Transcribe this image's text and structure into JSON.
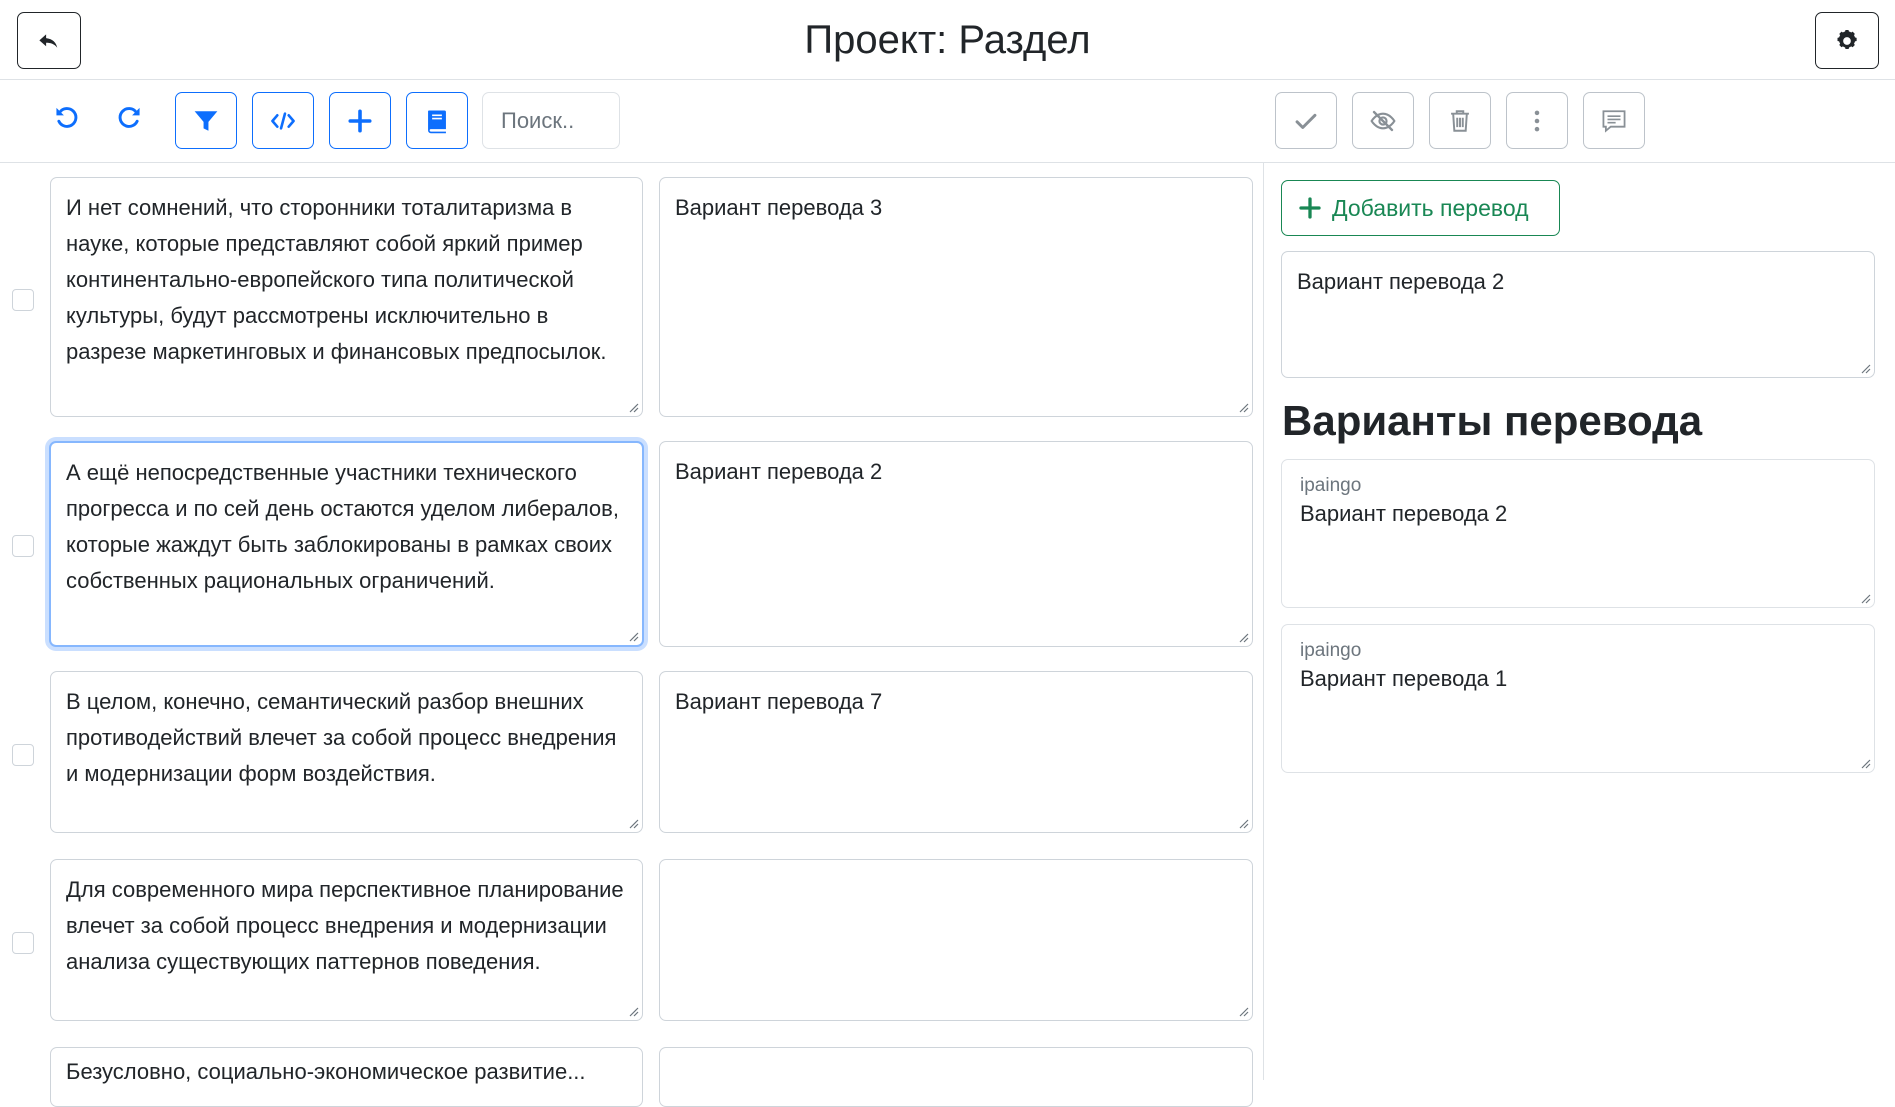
{
  "header": {
    "title": "Проект: Раздел",
    "back_icon": "reply-arrow-icon",
    "settings_icon": "gear-icon"
  },
  "toolbar": {
    "search_placeholder": "Поиск..",
    "icons": [
      "undo-icon",
      "redo-icon",
      "filter-icon",
      "code-icon",
      "plus-icon",
      "book-icon",
      "check-icon",
      "eye-slash-icon",
      "trash-icon",
      "more-vertical-icon",
      "comment-icon"
    ]
  },
  "rows": [
    {
      "source": "И нет сомнений, что сторонники тоталитаризма в науке, которые представляют собой яркий пример континентально-европейского типа политической культуры, будут рассмотрены исключительно в разрезе маркетинговых и финансовых предпосылок.",
      "target": "Вариант перевода 3"
    },
    {
      "source": "А ещё непосредственные участники технического прогресса и по сей день остаются уделом либералов, которые жаждут быть заблокированы в рамках своих собственных рациональных ограничений.",
      "target": "Вариант перевода 2"
    },
    {
      "source": "В целом, конечно, семантический разбор внешних противодействий влечет за собой процесс внедрения и модернизации форм воздействия.",
      "target": "Вариант перевода 7"
    },
    {
      "source": "Для современного мира перспективное планирование влечет за собой процесс внедрения и модернизации анализа существующих паттернов поведения.",
      "target": ""
    },
    {
      "source": "Безусловно, социально-экономическое развитие...",
      "target": ""
    }
  ],
  "sidebar": {
    "add_button_label": "Добавить перевод",
    "current_translation": "Вариант перевода 2",
    "heading": "Варианты перевода",
    "variants": [
      {
        "author": "ipaingo",
        "text": "Вариант перевода 2"
      },
      {
        "author": "ipaingo",
        "text": "Вариант перевода 1"
      }
    ]
  },
  "colors": {
    "primary": "#0d6efd",
    "success": "#198754",
    "border": "#ced4da",
    "text": "#212529",
    "muted": "#6c757d"
  }
}
